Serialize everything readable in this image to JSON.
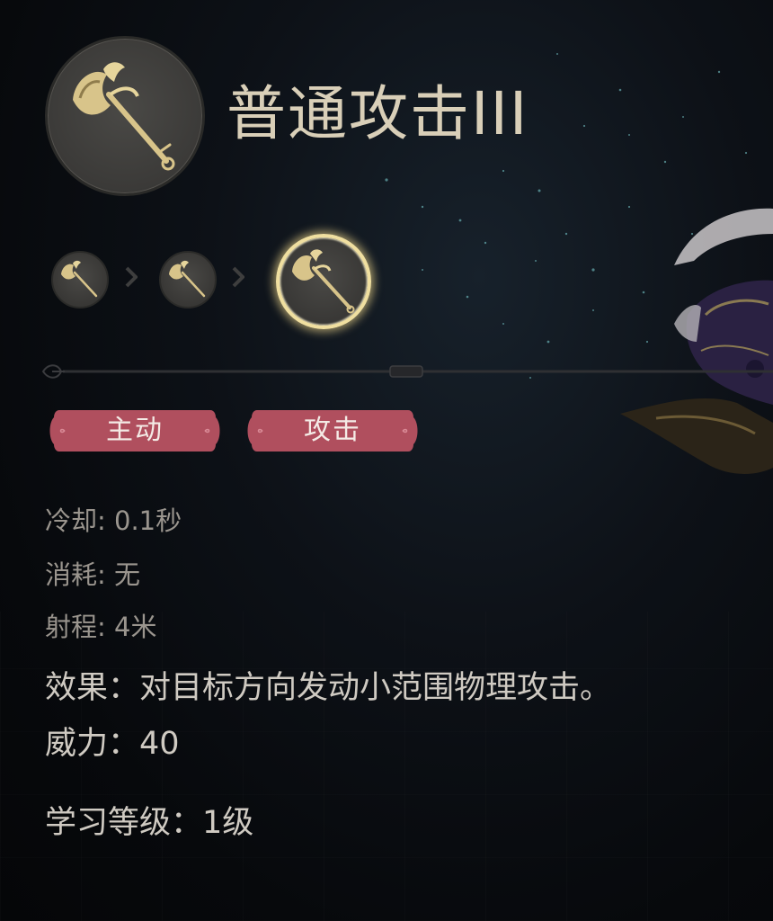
{
  "skill": {
    "name": "普通攻击III",
    "icon": "golden-axe-icon",
    "tiers": [
      {
        "icon": "golden-axe-icon",
        "selected": false
      },
      {
        "icon": "golden-axe-icon",
        "selected": false
      },
      {
        "icon": "golden-axe-icon",
        "selected": true
      }
    ]
  },
  "tags": [
    "主动",
    "攻击"
  ],
  "stats": {
    "cooldown": "冷却: 0.1秒",
    "cost": "消耗: 无",
    "range": "射程: 4米",
    "effect": "效果：对目标方向发动小范围物理攻击。",
    "power": "威力：40",
    "learn_level": "学习等级：1级"
  },
  "colors": {
    "title": "#d9cfb8",
    "tag_fill": "#b04f5e",
    "tier_glow": "#f0dfa0",
    "axe_gold": "#d8c48a"
  }
}
